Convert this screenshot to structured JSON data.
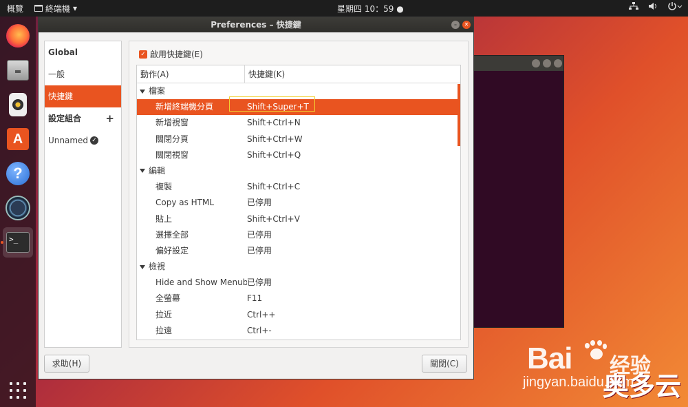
{
  "topbar": {
    "activities": "概覽",
    "app_name": "終端機",
    "clock": "星期四 10：59"
  },
  "dock": {
    "items": [
      "firefox-icon",
      "files-icon",
      "rhythmbox-icon",
      "software-store-icon",
      "help-icon",
      "software-updater-icon",
      "terminal-icon"
    ],
    "terminal_glyph": ">_"
  },
  "dialog": {
    "title": "Preferences – 快捷鍵",
    "sidebar": {
      "global_header": "Global",
      "general": "一般",
      "shortcuts": "快捷鍵",
      "profiles_header": "設定組合",
      "profile_name": "Unnamed"
    },
    "enable_shortcuts_label": "啟用快捷鍵(E)",
    "columns": {
      "action": "動作(A)",
      "shortcut": "快捷鍵(K)"
    },
    "groups": [
      {
        "name": "檔案",
        "rows": [
          {
            "action": "新增終端機分頁",
            "shortcut": "Shift+Super+T",
            "selected": true
          },
          {
            "action": "新增視窗",
            "shortcut": "Shift+Ctrl+N"
          },
          {
            "action": "關閉分頁",
            "shortcut": "Shift+Ctrl+W"
          },
          {
            "action": "關閉視窗",
            "shortcut": "Shift+Ctrl+Q"
          }
        ]
      },
      {
        "name": "編輯",
        "rows": [
          {
            "action": "複製",
            "shortcut": "Shift+Ctrl+C"
          },
          {
            "action": "Copy as HTML",
            "shortcut": "已停用"
          },
          {
            "action": "貼上",
            "shortcut": "Shift+Ctrl+V"
          },
          {
            "action": "選擇全部",
            "shortcut": "已停用"
          },
          {
            "action": "偏好設定",
            "shortcut": "已停用"
          }
        ]
      },
      {
        "name": "檢視",
        "rows": [
          {
            "action": "Hide and Show Menubar",
            "shortcut": "已停用"
          },
          {
            "action": "全螢幕",
            "shortcut": "F11"
          },
          {
            "action": "拉近",
            "shortcut": "Ctrl++"
          },
          {
            "action": "拉遠",
            "shortcut": "Ctrl+-"
          }
        ]
      }
    ],
    "help_button": "求助(H)",
    "close_button": "關閉(C)"
  },
  "watermark": {
    "brand": "Bai",
    "brand_suffix": "经验",
    "url": "jingyan.baidu.com",
    "overlay": "奥多云"
  },
  "colors": {
    "accent": "#e95420",
    "highlight_box": "#f2d031",
    "topbar": "#1d1d1d",
    "titlebar": "#3d3c38"
  }
}
